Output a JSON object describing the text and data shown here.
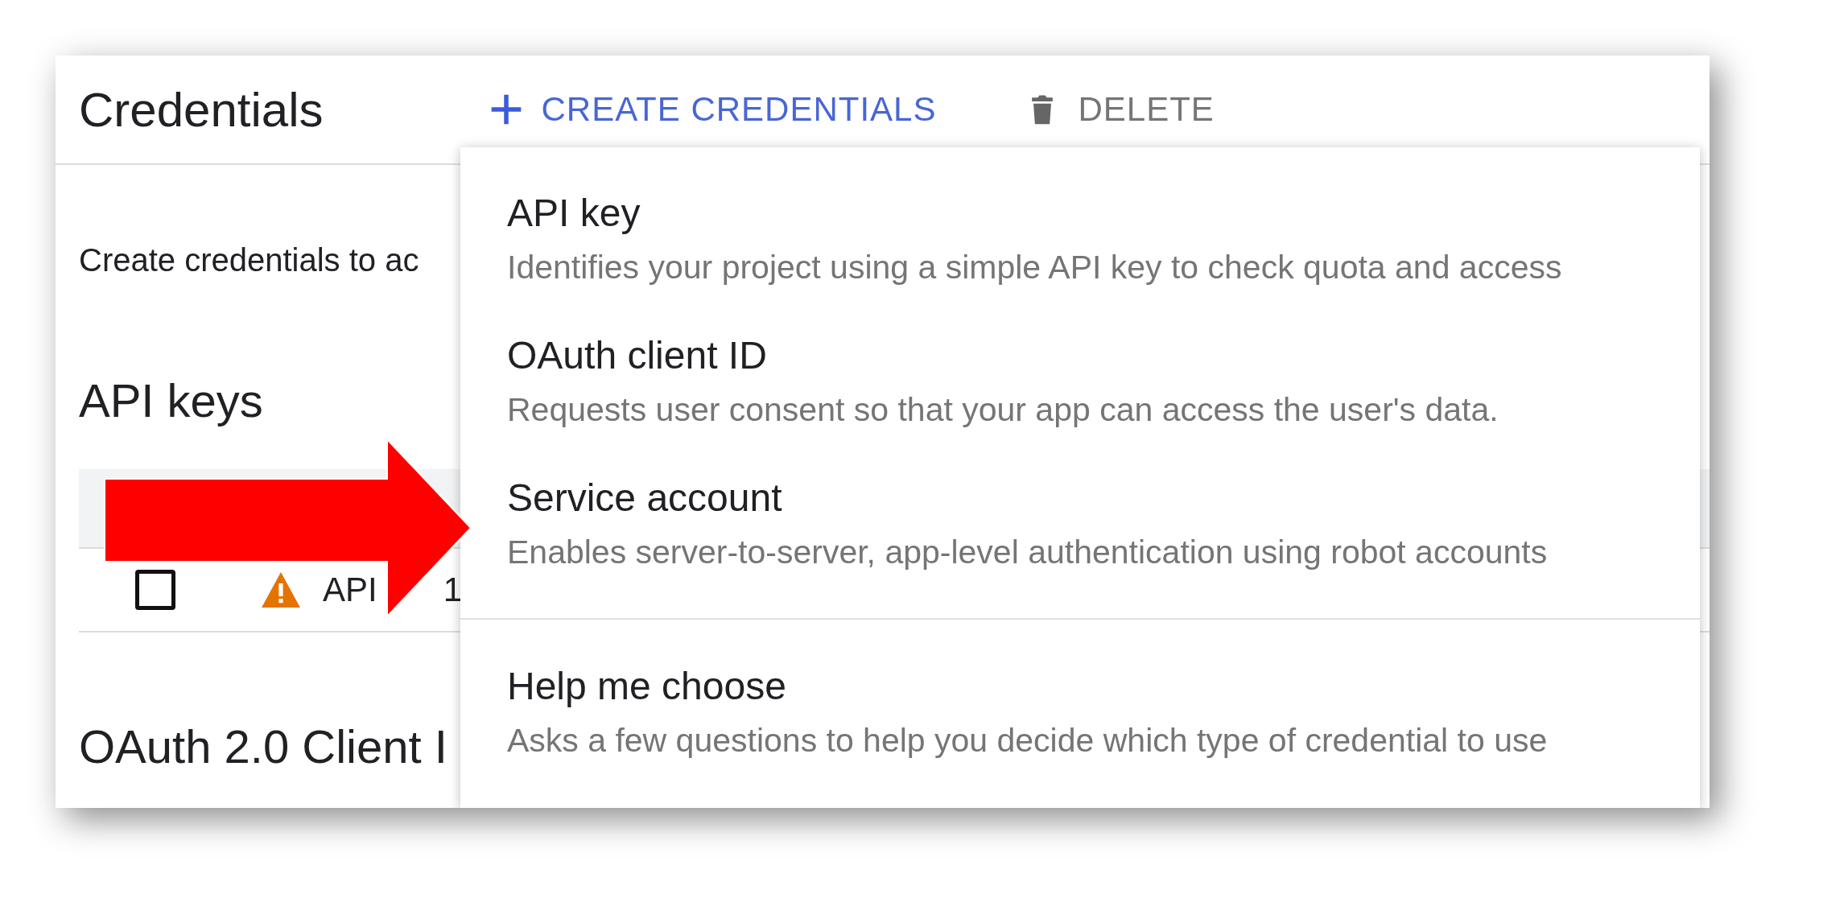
{
  "header": {
    "title": "Credentials",
    "actions": [
      {
        "label": "CREATE CREDENTIALS",
        "kind": "create"
      },
      {
        "label": "DELETE",
        "kind": "delete"
      }
    ]
  },
  "intro": "Create credentials to ac",
  "api_keys": {
    "heading": "API keys",
    "rows": [
      {
        "name_parts": [
          "API",
          "1"
        ],
        "checked": false,
        "warning": true
      }
    ]
  },
  "oauth_heading": "OAuth 2.0 Client I",
  "menu": {
    "items": [
      {
        "title": "API key",
        "description": "Identifies your project using a simple API key to check quota and access"
      },
      {
        "title": "OAuth client ID",
        "description": "Requests user consent so that your app can access the user's data."
      },
      {
        "title": "Service account",
        "description": "Enables server-to-server, app-level authentication using robot accounts"
      }
    ],
    "footer_item": {
      "title": "Help me choose",
      "description": "Asks a few questions to help you decide which type of credential to use"
    }
  }
}
